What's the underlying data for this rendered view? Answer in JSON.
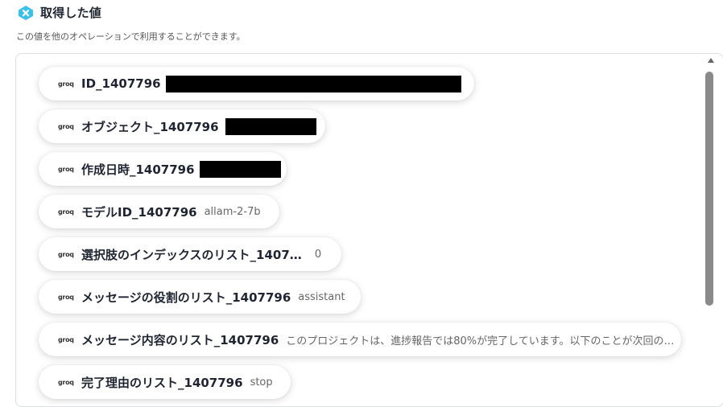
{
  "header": {
    "title": "取得した値",
    "icon": "x-close-hex-icon",
    "accent": "#3cc0e8"
  },
  "subtitle": "この値を他のオペレーションで利用することができます。",
  "provider_logo": "groq",
  "items": [
    {
      "label": "ID_1407796",
      "value": "",
      "redacted": true
    },
    {
      "label": "オブジェクト_1407796",
      "value": "",
      "redacted": true
    },
    {
      "label": "作成日時_1407796",
      "value": "",
      "redacted": true
    },
    {
      "label": "モデルID_1407796",
      "value": "allam-2-7b",
      "redacted": false
    },
    {
      "label": "選択肢のインデックスのリスト_1407…",
      "value": "0",
      "redacted": false
    },
    {
      "label": "メッセージの役割のリスト_1407796",
      "value": "assistant",
      "redacted": false
    },
    {
      "label": "メッセージ内容のリスト_1407796",
      "value": "このプロジェクトは、進捗報告では80%が完了しています。以下のことが次回の…",
      "redacted": false
    },
    {
      "label": "完了理由のリスト_1407796",
      "value": "stop",
      "redacted": false
    }
  ]
}
